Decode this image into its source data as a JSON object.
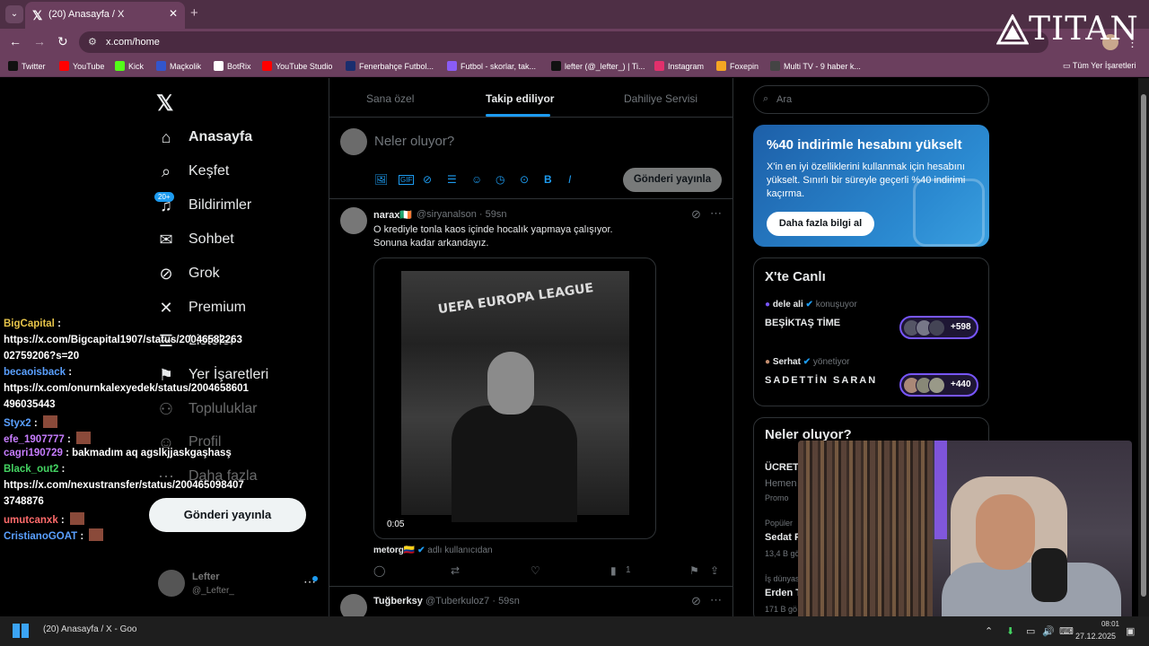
{
  "browser": {
    "tab_title": "(20) Anasayfa / X",
    "tab_close": "✕",
    "tab_dropdown": "⌄",
    "new_tab": "+",
    "url": "x.com/home",
    "back": "←",
    "forward": "→",
    "reload": "↻",
    "overlay_logo": "TITAN",
    "menu": "⋮",
    "bookmarks": [
      {
        "label": "Twitter",
        "color": "#111111"
      },
      {
        "label": "YouTube",
        "color": "#ff0000"
      },
      {
        "label": "Kick",
        "color": "#53fc18"
      },
      {
        "label": "Maçkolik",
        "color": "#3355cc"
      },
      {
        "label": "BotRix",
        "color": "#ffffff"
      },
      {
        "label": "YouTube Studio",
        "color": "#ff0000"
      },
      {
        "label": "Fenerbahçe Futbol...",
        "color": "#1a2e6e"
      },
      {
        "label": "Futbol - skorlar, tak...",
        "color": "#8a5cf5"
      },
      {
        "label": "lefter (@_lefter_) | Ti...",
        "color": "#111111"
      },
      {
        "label": "Instagram",
        "color": "#e1306c"
      },
      {
        "label": "Foxepin",
        "color": "#f5a623"
      },
      {
        "label": "Multi TV - 9 haber k...",
        "color": "#444444"
      }
    ],
    "all_bookmarks": "Tüm Yer İşaretleri"
  },
  "sidebar": {
    "badge": "20+",
    "items": [
      {
        "label": "Anasayfa",
        "icon": "home-icon",
        "glyph": "⌂"
      },
      {
        "label": "Keşfet",
        "icon": "search-icon",
        "glyph": "⌕"
      },
      {
        "label": "Bildirimler",
        "icon": "bell-icon",
        "glyph": "♫"
      },
      {
        "label": "Sohbet",
        "icon": "mail-icon",
        "glyph": "✉"
      },
      {
        "label": "Grok",
        "icon": "grok-icon",
        "glyph": "⊘"
      },
      {
        "label": "Premium",
        "icon": "x-premium-icon",
        "glyph": "✕"
      },
      {
        "label": "Listeler",
        "icon": "list-icon",
        "glyph": "☰"
      },
      {
        "label": "Yer İşaretleri",
        "icon": "bookmark-icon",
        "glyph": "⚑"
      },
      {
        "label": "Topluluklar",
        "icon": "communities-icon",
        "glyph": "⚇"
      },
      {
        "label": "Profil",
        "icon": "profile-icon",
        "glyph": "☺"
      },
      {
        "label": "Daha fazla",
        "icon": "more-icon",
        "glyph": "⋯"
      }
    ],
    "post_button": "Gönderi yayınla",
    "account": {
      "name": "Lefter",
      "handle": "@_Lefter_"
    },
    "account_more": "⋯"
  },
  "chat": [
    {
      "user": "BigCapital",
      "color": "y",
      "text": ""
    },
    {
      "user": "",
      "color": "",
      "text": "https://x.com/Bigcapital1907/status/20046582263"
    },
    {
      "user": "",
      "color": "",
      "text": "02759206?s=20"
    },
    {
      "user": "becaoisback",
      "color": "b",
      "text": ""
    },
    {
      "user": "",
      "color": "",
      "text": "https://x.com/onurnkalexyedek/status/2004658601"
    },
    {
      "user": "",
      "color": "",
      "text": "496035443"
    },
    {
      "user": "Styx2",
      "color": "b",
      "text": ""
    },
    {
      "user": "efe_1907777",
      "color": "p",
      "text": ""
    },
    {
      "user": "cagri190729",
      "color": "p",
      "text": "bakmadım aq agslkjjaskgaşhasş"
    },
    {
      "user": "Black_out2",
      "color": "g",
      "text": ""
    },
    {
      "user": "",
      "color": "",
      "text": "https://x.com/nexustransfer/status/200465098407"
    },
    {
      "user": "",
      "color": "",
      "text": "3748876"
    },
    {
      "user": "umutcanxk",
      "color": "r",
      "text": ""
    },
    {
      "user": "CristianoGOAT",
      "color": "b",
      "text": ""
    }
  ],
  "timeline": {
    "tabs": [
      "Sana özel",
      "Takip ediliyor",
      "Dahiliye Servisi"
    ],
    "compose_placeholder": "Neler oluyor?",
    "compose_post": "Gönderi yayınla",
    "compose_tools": [
      "🖼",
      "GIF",
      "⊘",
      "☰",
      "☺",
      "◷",
      "⊙",
      "B",
      "I"
    ],
    "tweet": {
      "name": "narax🇮🇪",
      "handle": "@siryanalson · 59sn",
      "text_line1": "O krediyle tonla kaos içinde hocalık yapmaya çalışıyor.",
      "text_line2": "Sonuna kadar arkandayız.",
      "image_text": "UEFA EUROPA LEAGUE",
      "media_time": "0:05",
      "caption_user": "metorg🇨🇴",
      "caption_sub": "adlı kullanıcıdan",
      "views": "1"
    },
    "tweet2": {
      "name": "Tuğberksy",
      "handle": "@Tuberkuloz7 · 59sn"
    }
  },
  "right": {
    "search_placeholder": "Ara",
    "promo": {
      "title": "%40 indirimle hesabını yükselt",
      "text": "X'in en iyi özelliklerini kullanmak için hesabını yükselt. Sınırlı bir süreyle geçerli %40 indirimi kaçırma.",
      "button": "Daha fazla bilgi al"
    },
    "live": {
      "title": "X'te Canlı",
      "spaces": [
        {
          "host": "dele ali",
          "role": "konuşuyor",
          "room": "BEŞİKTAŞ TİME",
          "count": "+598"
        },
        {
          "host": "Serhat",
          "role": "yönetiyor",
          "room": "SADETTİN SARAN",
          "count": "+440"
        }
      ]
    },
    "trends": {
      "title": "Neler oluyor?",
      "items": [
        {
          "small": "",
          "big": "ÜCRETS"
        },
        {
          "small": "Hemen",
          "big": ""
        },
        {
          "small": "Promo",
          "big": ""
        },
        {
          "small": "Popüler",
          "big": "Sedat P"
        },
        {
          "small": "13,4 B gö",
          "big": ""
        },
        {
          "small": "İş dünyası",
          "big": "Erden T"
        },
        {
          "small": "171 B gö",
          "big": ""
        }
      ]
    }
  },
  "taskbar": {
    "task": "(20) Anasayfa / X - Goo",
    "time": "08:01",
    "date": "27.12.2025"
  }
}
